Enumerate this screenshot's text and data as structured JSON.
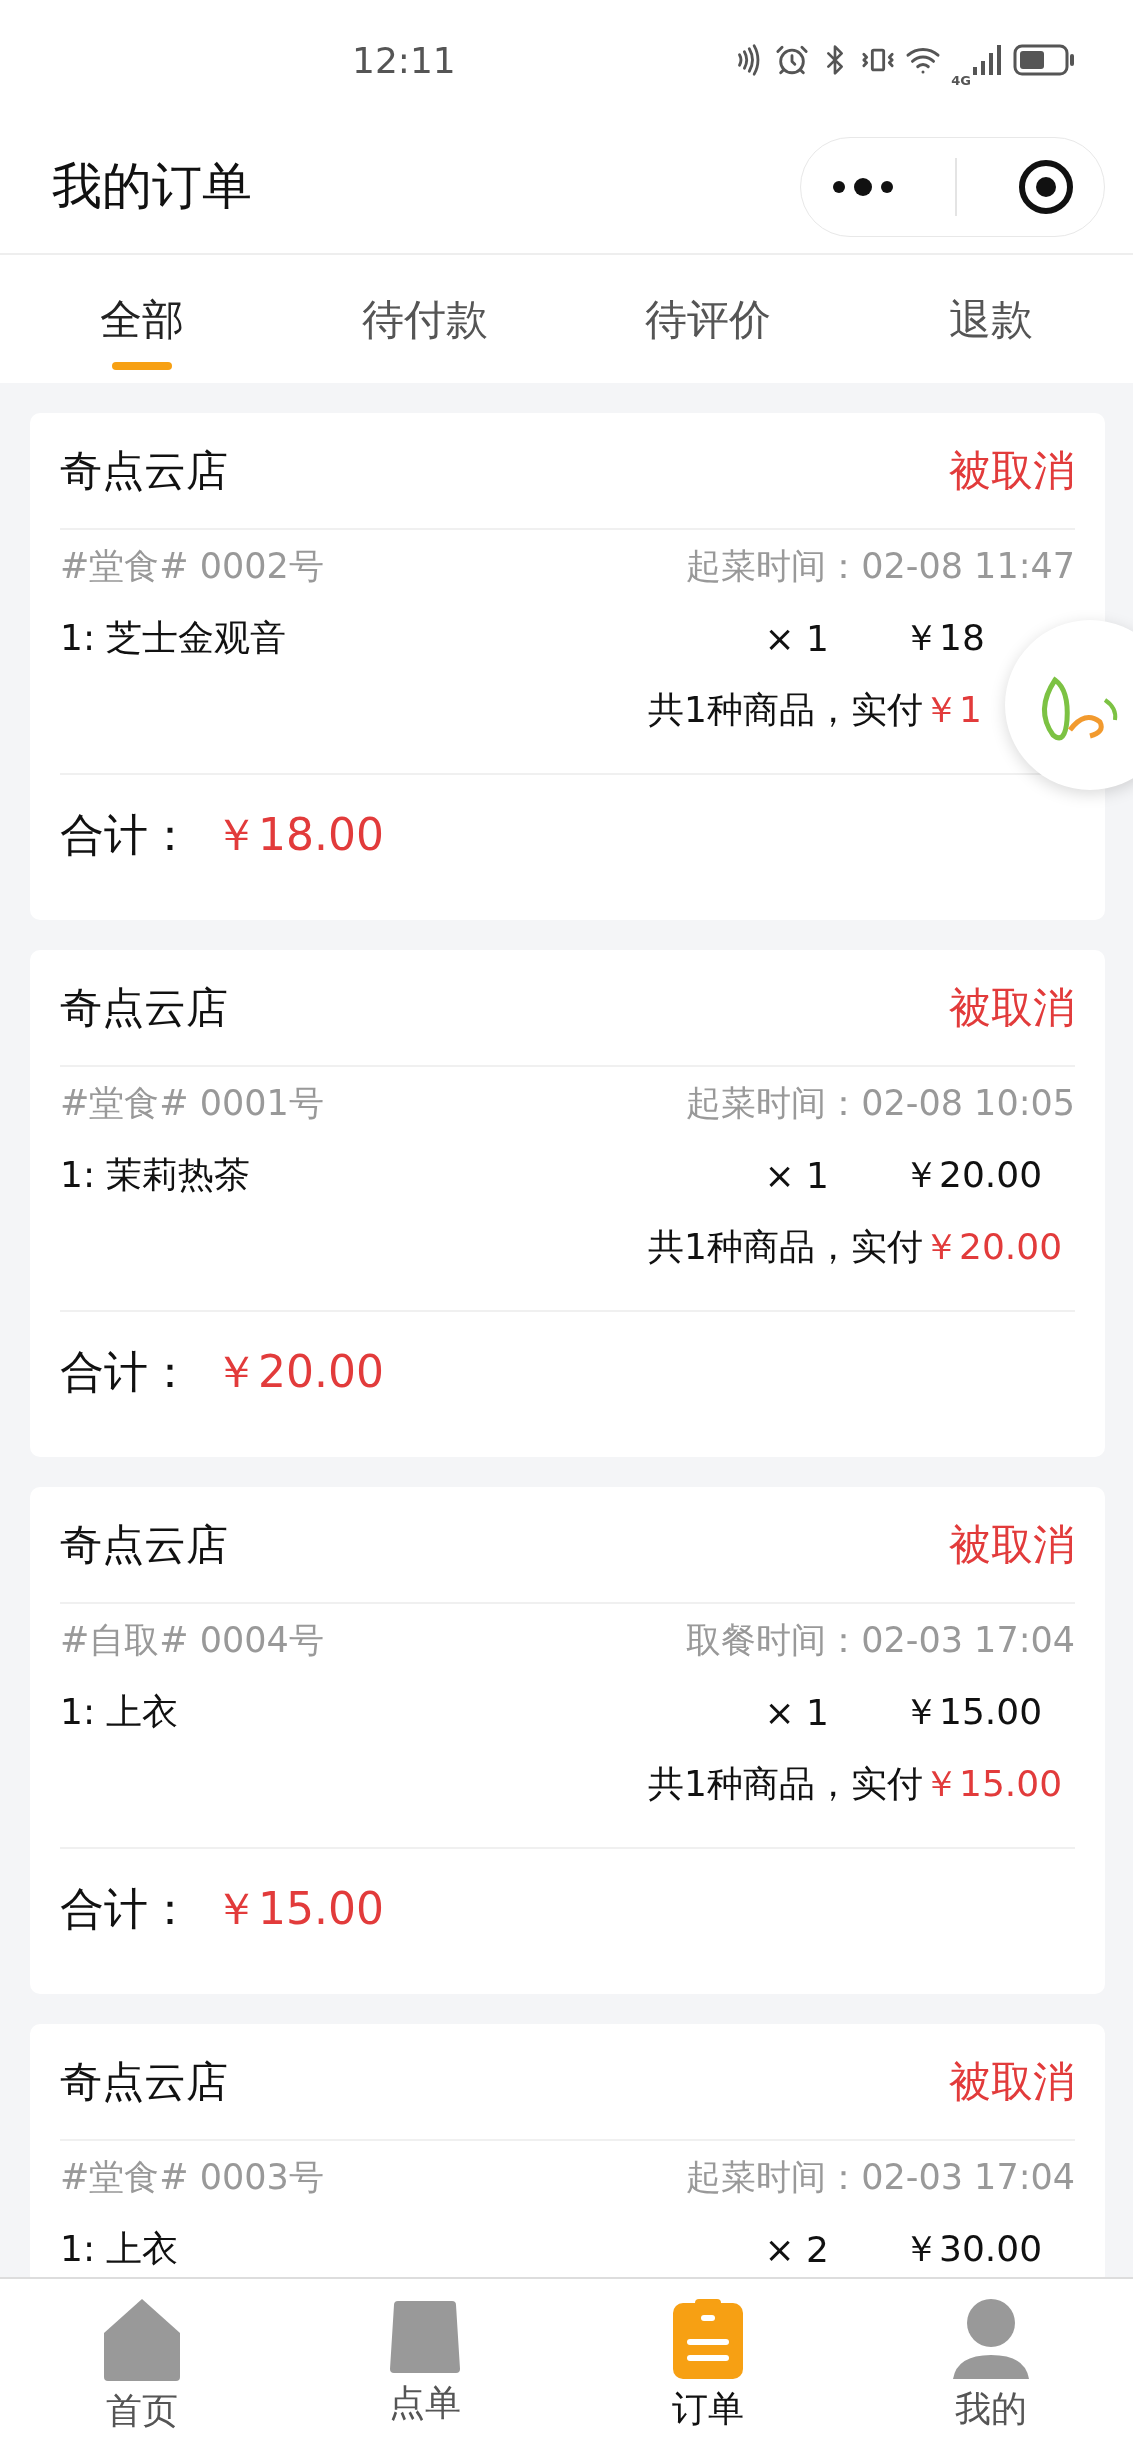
{
  "status_bar": {
    "time": "12:11",
    "network": "4G"
  },
  "header": {
    "title": "我的订单"
  },
  "tabs": [
    {
      "label": "全部",
      "selected": true
    },
    {
      "label": "待付款",
      "selected": false
    },
    {
      "label": "待评价",
      "selected": false
    },
    {
      "label": "退款",
      "selected": false
    }
  ],
  "orders": [
    {
      "store": "奇点云店",
      "status": "被取消",
      "order_info": "#堂食# 0002号",
      "time": "起菜时间：02-08 11:47",
      "items": [
        {
          "name": "1: 芝士金观音",
          "qty": "× 1",
          "price": "￥18"
        }
      ],
      "summary_label": "共1种商品，实付",
      "paid": "￥1",
      "total_label": "合计：",
      "total": "￥18.00"
    },
    {
      "store": "奇点云店",
      "status": "被取消",
      "order_info": "#堂食# 0001号",
      "time": "起菜时间：02-08 10:05",
      "items": [
        {
          "name": "1: 茉莉热茶",
          "qty": "× 1",
          "price": "￥20.00"
        }
      ],
      "summary_label": "共1种商品，实付",
      "paid": "￥20.00",
      "total_label": "合计：",
      "total": "￥20.00"
    },
    {
      "store": "奇点云店",
      "status": "被取消",
      "order_info": "#自取# 0004号",
      "time": "取餐时间：02-03 17:04",
      "items": [
        {
          "name": "1: 上衣",
          "qty": "× 1",
          "price": "￥15.00"
        }
      ],
      "summary_label": "共1种商品，实付",
      "paid": "￥15.00",
      "total_label": "合计：",
      "total": "￥15.00"
    },
    {
      "store": "奇点云店",
      "status": "被取消",
      "order_info": "#堂食# 0003号",
      "time": "起菜时间：02-03 17:04",
      "items": [
        {
          "name": "1: 上衣",
          "qty": "× 2",
          "price": "￥30.00"
        }
      ]
    }
  ],
  "bottom_nav": [
    {
      "label": "首页",
      "kind": "home",
      "selected": false
    },
    {
      "label": "点单",
      "kind": "bag",
      "selected": false
    },
    {
      "label": "订单",
      "kind": "orders",
      "selected": true
    },
    {
      "label": "我的",
      "kind": "profile",
      "selected": false
    }
  ]
}
